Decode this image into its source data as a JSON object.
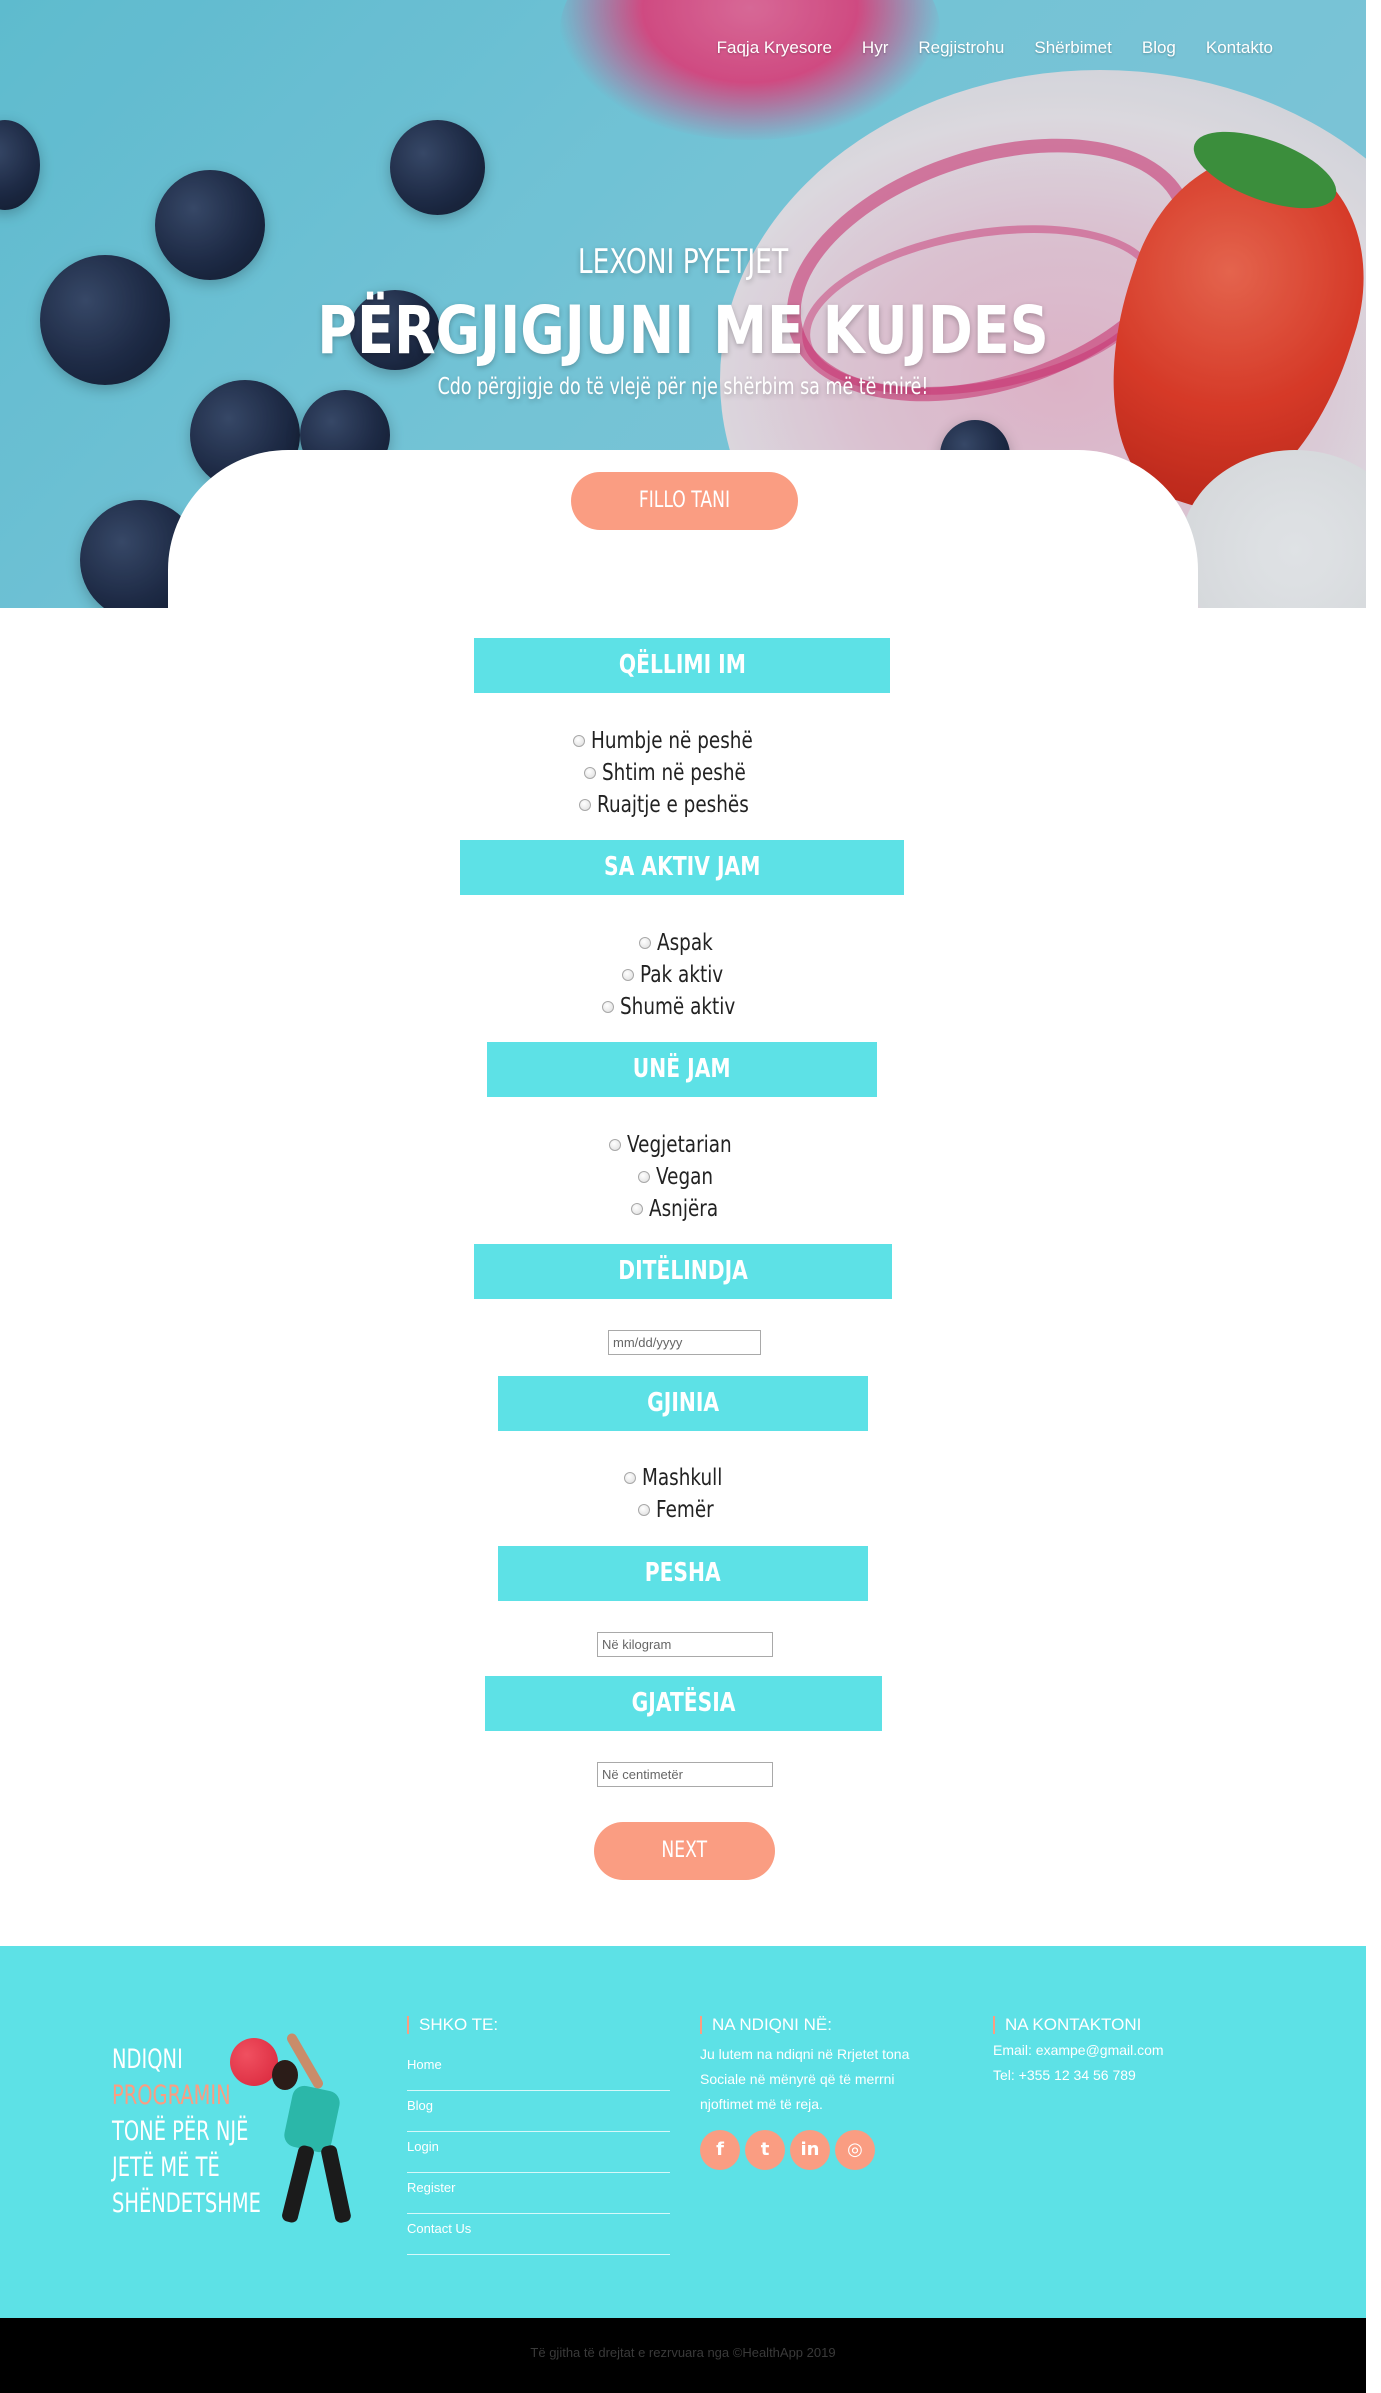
{
  "nav": {
    "items": [
      "Faqja Kryesore",
      "Hyr",
      "Regjistrohu",
      "Shërbimet",
      "Blog",
      "Kontakto"
    ]
  },
  "hero": {
    "subtitle": "LEXONI PYETJET",
    "title": "PËRGJIGJUNI ME KUJDES",
    "tagline": "Cdo përgjigje do të vlejë për nje shërbim sa më të mirë!",
    "start_button": "FILLO TANI"
  },
  "form": {
    "goal": {
      "heading": "QËLLIMI IM",
      "options": [
        "Humbje në peshë",
        "Shtim në peshë",
        "Ruajtje e peshës"
      ]
    },
    "activity": {
      "heading": "SA AKTIV JAM",
      "options": [
        "Aspak",
        "Pak aktiv",
        "Shumë aktiv"
      ]
    },
    "diet": {
      "heading": "UNË JAM",
      "options": [
        "Vegjetarian",
        "Vegan",
        "Asnjëra"
      ]
    },
    "birthday": {
      "heading": "DITËLINDJA",
      "placeholder": "mm/dd/yyyy"
    },
    "gender": {
      "heading": "GJINIA",
      "options": [
        "Mashkull",
        "Femër"
      ]
    },
    "weight": {
      "heading": "PESHA",
      "placeholder": "Në kilogram"
    },
    "height": {
      "heading": "GJATËSIA",
      "placeholder": "Në centimetër"
    },
    "next_button": "NEXT"
  },
  "footer": {
    "promo": {
      "line1": "NDIQNI",
      "line2": "PROGRAMIN",
      "line3": "TONË PËR NJË",
      "line4": "JETË MË TË",
      "line5": "SHËNDETSHME"
    },
    "goto": {
      "heading": "SHKO TE:",
      "links": [
        "Home",
        "Blog",
        "Login",
        "Register",
        "Contact Us"
      ]
    },
    "follow": {
      "heading": "NA NDIQNI NË:",
      "text": "Ju lutem na ndiqni në Rrjetet tona Sociale në mënyrë që të merrni njoftimet më të reja."
    },
    "contact": {
      "heading": "NA KONTAKTONI",
      "email": "Email: exampe@gmail.com",
      "phone": "Tel: +355 12 34 56 789"
    },
    "socials": [
      {
        "icon": "facebook-icon",
        "glyph": "f"
      },
      {
        "icon": "twitter-icon",
        "glyph": "t"
      },
      {
        "icon": "linkedin-icon",
        "glyph": "in"
      },
      {
        "icon": "instagram-icon",
        "glyph": "◎"
      }
    ],
    "copyright": "Të gjitha të drejtat e rezrvuara nga ©HealthApp 2019"
  },
  "colors": {
    "accent": "#fa9d82",
    "teal": "#5de1e6"
  }
}
